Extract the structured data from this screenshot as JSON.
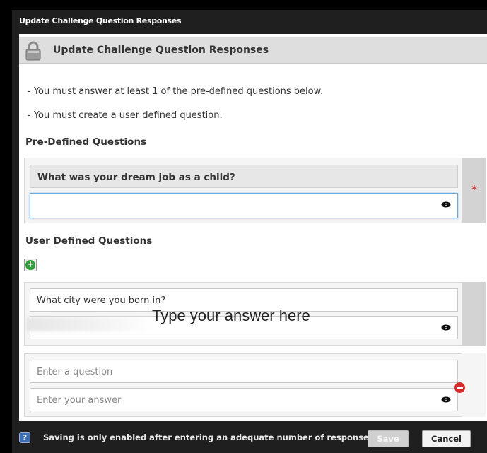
{
  "window": {
    "title": "Update Challenge Question Responses"
  },
  "header": {
    "title": "Update Challenge Question Responses",
    "icon": "lock-icon"
  },
  "rules": [
    "- You must answer at least 1 of the pre-defined questions below.",
    "- You must create a user defined question."
  ],
  "predefined": {
    "section_title": "Pre-Defined Questions",
    "question": "What was your dream job as a child?",
    "answer_value": "",
    "required_mark": "*"
  },
  "user_defined": {
    "section_title": "User Defined Questions",
    "items": [
      {
        "question_value": "What city were you born in?",
        "answer_overlay": "Type your answer here"
      },
      {
        "question_placeholder": "Enter a question",
        "answer_placeholder": "Enter your answer"
      }
    ]
  },
  "footer": {
    "message": "Saving is only enabled after entering an adequate number of responses",
    "save_label": "Save",
    "cancel_label": "Cancel",
    "help_icon": "help-icon"
  },
  "colors": {
    "required": "#d23a3a",
    "add": "#2f9d38",
    "remove": "#d72a2a",
    "focus": "#6aa8de"
  }
}
